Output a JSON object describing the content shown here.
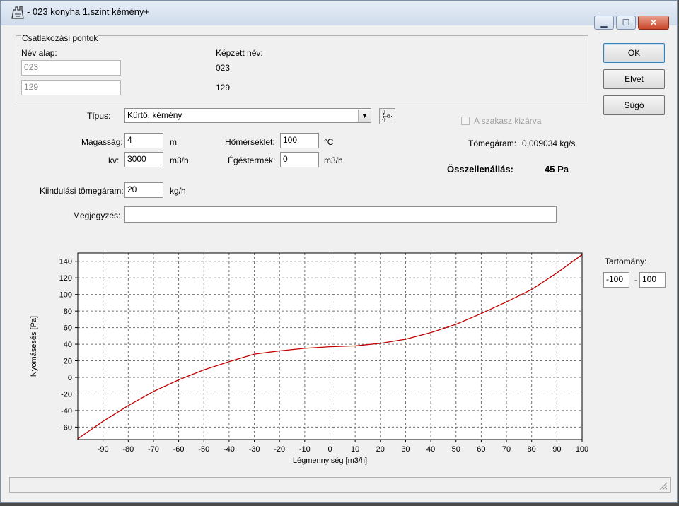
{
  "window": {
    "title": "- 023 konyha 1.szint kémény+"
  },
  "group": {
    "legend": "Csatlakozási pontok",
    "name_base_label": "Név alap:",
    "built_name_label": "Képzett név:",
    "rows": [
      {
        "base": "023",
        "built": "023"
      },
      {
        "base": "129",
        "built": "129"
      }
    ]
  },
  "buttons": {
    "ok": "OK",
    "cancel": "Elvet",
    "help": "Súgó"
  },
  "form": {
    "type_label": "Típus:",
    "type_value": "Kürtő, kémény",
    "height_label": "Magasság:",
    "height_value": "4",
    "height_unit": "m",
    "kv_label": "kv:",
    "kv_value": "3000",
    "kv_unit": "m3/h",
    "temp_label": "Hőmérséklet:",
    "temp_value": "100",
    "temp_unit": "°C",
    "exhaust_label": "Égéstermék:",
    "exhaust_value": "0",
    "exhaust_unit": "m3/h",
    "start_mass_label": "Kiindulási tömegáram:",
    "start_mass_value": "20",
    "start_mass_unit": "kg/h",
    "note_label": "Megjegyzés:",
    "note_value": ""
  },
  "status": {
    "excluded_label": "A szakasz kizárva",
    "excluded_checked": false,
    "massflow_label": "Tömegáram:",
    "massflow_value": "0,009034 kg/s",
    "total_resistance_label": "Összellenállás:",
    "total_resistance_value": "45 Pa"
  },
  "range": {
    "label": "Tartomány:",
    "min": "-100",
    "separator": "-",
    "max": "100"
  },
  "chart_data": {
    "type": "line",
    "xlabel": "Légmennyiség [m3/h]",
    "ylabel": "Nyomásesés [Pa]",
    "xlim": [
      -100,
      100
    ],
    "ylim": [
      -75,
      150
    ],
    "x_ticks": [
      -90,
      -80,
      -70,
      -60,
      -50,
      -40,
      -30,
      -20,
      -10,
      0,
      10,
      20,
      30,
      40,
      50,
      60,
      70,
      80,
      90,
      100
    ],
    "y_ticks": [
      -60,
      -40,
      -20,
      0,
      20,
      40,
      60,
      80,
      100,
      120,
      140
    ],
    "grid": true,
    "line_color": "#c00000",
    "series": [
      {
        "x": [
          -100,
          -90,
          -80,
          -70,
          -60,
          -50,
          -40,
          -30,
          -20,
          -10,
          0,
          10,
          20,
          30,
          40,
          50,
          60,
          70,
          80,
          90,
          100
        ],
        "y": [
          -74,
          -53,
          -34,
          -17,
          -3,
          9,
          19,
          28,
          32,
          35,
          37,
          38,
          41,
          46,
          54,
          64,
          77,
          91,
          106,
          126,
          148
        ]
      }
    ]
  }
}
